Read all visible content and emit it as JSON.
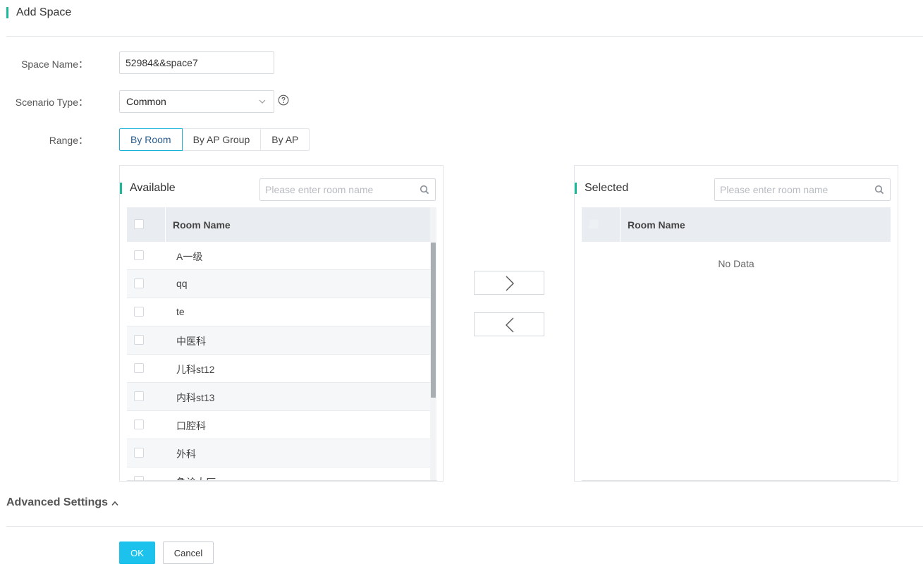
{
  "header": {
    "title": "Add Space"
  },
  "form": {
    "space_name": {
      "label": "Space Name：",
      "value": "52984&&space7"
    },
    "scenario_type": {
      "label": "Scenario Type：",
      "value": "Common",
      "help_icon": "question-circle-icon"
    },
    "range": {
      "label": "Range：",
      "options": [
        "By Room",
        "By AP Group",
        "By AP"
      ],
      "selected": "By Room"
    }
  },
  "available": {
    "title": "Available",
    "search_placeholder": "Please enter room name",
    "column": "Room Name",
    "rows": [
      "A一级",
      "qq",
      "te",
      "中医科",
      "儿科st12",
      "内科st13",
      "口腔科",
      "外科",
      "急诊大厅"
    ]
  },
  "selected": {
    "title": "Selected",
    "search_placeholder": "Please enter room name",
    "column": "Room Name",
    "empty_text": "No Data"
  },
  "transfer": {
    "right_icon": "chevron-right-icon",
    "left_icon": "chevron-left-icon"
  },
  "advanced": {
    "label": "Advanced Settings",
    "icon": "chevron-up-icon"
  },
  "footer": {
    "ok_label": "OK",
    "cancel_label": "Cancel"
  },
  "colors": {
    "accent": "#1bb99a",
    "primary": "#1cc2ec",
    "active_border": "#19b0d6"
  }
}
